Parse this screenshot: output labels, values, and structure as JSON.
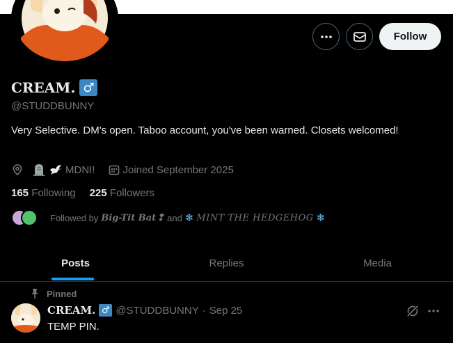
{
  "profile": {
    "display_name": "CREAM.",
    "gender_badge": "♂",
    "handle": "@STUDDBUNNY",
    "bio": "Very Selective. DM's open. Taboo account, you've been warned. Closets welcomed!",
    "location_text": "MDNI!",
    "joined": "Joined September 2025",
    "following_count": "165",
    "following_label": "Following",
    "followers_count": "225",
    "followers_label": "Followers",
    "followed_by_prefix": "Followed by",
    "followed_by_user1": "Big-Tit Bat",
    "followed_by_user1_mark": "❢",
    "followed_by_and": "and",
    "followed_by_user2": "MINT THE HEDGEHOG",
    "snowflake": "❄"
  },
  "actions": {
    "follow_label": "Follow",
    "more_icon": "more-horizontal-icon",
    "message_icon": "envelope-icon"
  },
  "tabs": [
    {
      "label": "Posts",
      "active": true
    },
    {
      "label": "Replies",
      "active": false
    },
    {
      "label": "Media",
      "active": false
    }
  ],
  "pinned_post": {
    "pinned_label": "Pinned",
    "author_name": "CREAM.",
    "badge": "♂",
    "handle": "@STUDDBUNNY",
    "separator": "·",
    "date": "Sep 25",
    "text": "TEMP PIN."
  },
  "colors": {
    "background": "#000000",
    "accent": "#1d9bf0",
    "muted": "#71767b",
    "badge_blue": "#3b88c3"
  }
}
